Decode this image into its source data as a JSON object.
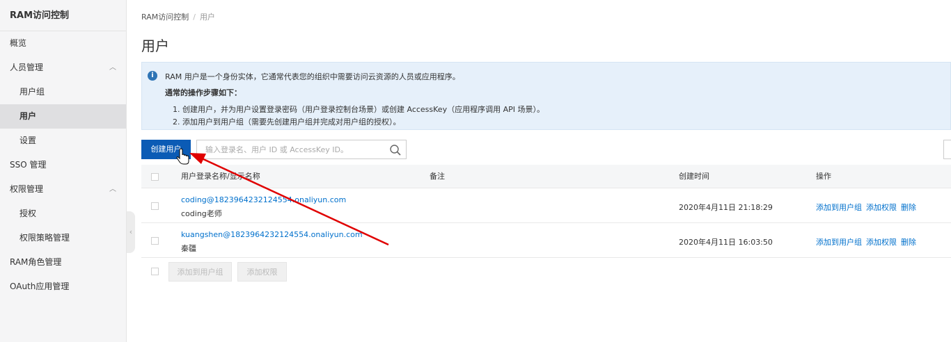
{
  "sidebar": {
    "title": "RAM访问控制",
    "items": [
      {
        "label": "概览"
      },
      {
        "label": "人员管理"
      },
      {
        "label": "用户组"
      },
      {
        "label": "用户"
      },
      {
        "label": "设置"
      },
      {
        "label": "SSO 管理"
      },
      {
        "label": "权限管理"
      },
      {
        "label": "授权"
      },
      {
        "label": "权限策略管理"
      },
      {
        "label": "RAM角色管理"
      },
      {
        "label": "OAuth应用管理"
      }
    ]
  },
  "breadcrumb": {
    "root": "RAM访问控制",
    "sep": "/",
    "current": "用户"
  },
  "page_title": "用户",
  "info": {
    "line1": "RAM 用户是一个身份实体，它通常代表您的组织中需要访问云资源的人员或应用程序。",
    "heading": "通常的操作步骤如下：",
    "step1": "1. 创建用户，并为用户设置登录密码（用户登录控制台场景）或创建 AccessKey（应用程序调用 API 场景）。",
    "step2": "2. 添加用户到用户组（需要先创建用户组并完成对用户组的授权）。"
  },
  "toolbar": {
    "create_label": "创建用户",
    "search_placeholder": "输入登录名、用户 ID 或 AccessKey ID。"
  },
  "table": {
    "headers": {
      "name": "用户登录名称/显示名称",
      "note": "备注",
      "created": "创建时间",
      "ops": "操作"
    },
    "rows": [
      {
        "login": "coding@1823964232124554.onaliyun.com",
        "display": "coding老师",
        "note": "",
        "created": "2020年4月11日 21:18:29",
        "ops": [
          "添加到用户组",
          "添加权限",
          "删除"
        ]
      },
      {
        "login": "kuangshen@1823964232124554.onaliyun.com",
        "display": "秦疆",
        "note": "",
        "created": "2020年4月11日 16:03:50",
        "ops": [
          "添加到用户组",
          "添加权限",
          "删除"
        ]
      }
    ]
  },
  "bulk": {
    "add_group": "添加到用户组",
    "add_perm": "添加权限"
  },
  "colors": {
    "primary": "#0b5bb5",
    "link": "#0070cc",
    "accent": "#ff6a00",
    "annotation": "#e00000"
  }
}
